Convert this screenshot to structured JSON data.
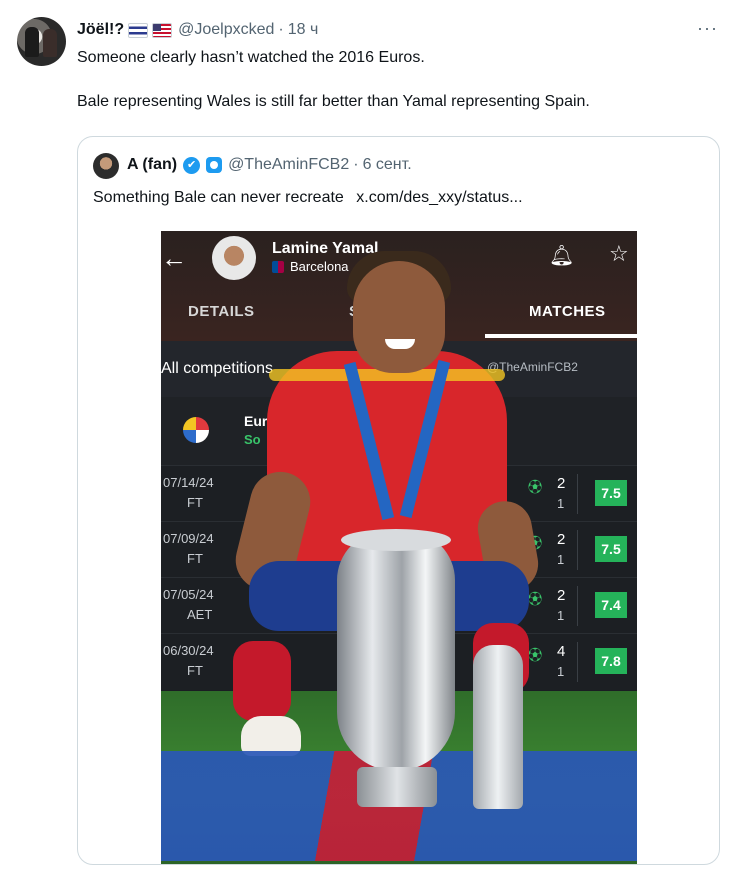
{
  "tweet": {
    "name": "Jöël!?",
    "handle": "@Joelpxcked",
    "separator": "·",
    "time": "18 ч",
    "more": "···",
    "paragraphs": [
      "Someone clearly hasn’t watched the 2016 Euros.",
      "Bale representing Wales is still far better than Yamal representing Spain."
    ]
  },
  "quote": {
    "name": "A (fan)",
    "verified_glyph": "✔",
    "handle": "@TheAminFCB2",
    "separator": "·",
    "time": "6 сент.",
    "text": "Something Bale can never recreate",
    "link": "x.com/des_xxy/status..."
  },
  "embedded": {
    "player_name": "Lamine Yamal",
    "club": "Barcelona",
    "tabs": [
      "DETAILS",
      "S",
      "MATCHES"
    ],
    "active_tab": "MATCHES",
    "filter": "All competitions",
    "watermark": "@TheAminFCB2",
    "league_name": "Eur",
    "league_sub": "So",
    "matches": [
      {
        "date": "07/14/24",
        "status": "FT",
        "g": "2",
        "a": "1",
        "rating": "7.5"
      },
      {
        "date": "07/09/24",
        "status": "FT",
        "g": "2",
        "a": "1",
        "rating": "7.5"
      },
      {
        "date": "07/05/24",
        "status": "AET",
        "g": "2",
        "a": "1",
        "rating": "7.4"
      },
      {
        "date": "06/30/24",
        "status": "FT",
        "g": "4",
        "a": "1",
        "rating": "7.8"
      }
    ],
    "rating_color": "#25b35a"
  },
  "colors": {
    "text": "#0f1419",
    "muted": "#536471",
    "border": "#cfd9de",
    "verified": "#1d9bf0"
  }
}
